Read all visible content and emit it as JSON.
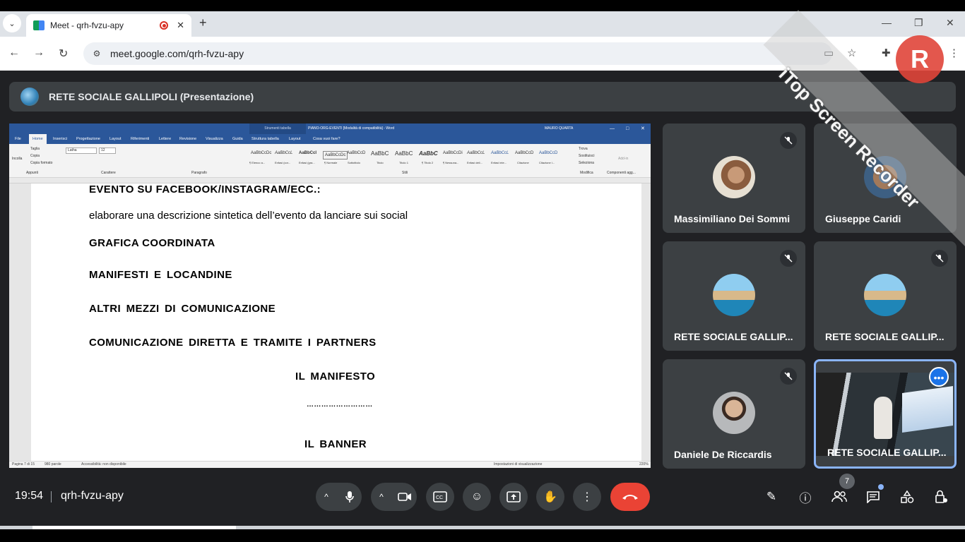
{
  "browser": {
    "tab_title": "Meet - qrh-fvzu-apy",
    "url": "meet.google.com/qrh-fvzu-apy"
  },
  "meet": {
    "presenter_label": "RETE SOCIALE GALLIPOLI (Presentazione)",
    "clock": "19:54",
    "meeting_code": "qrh-fvzu-apy",
    "participant_count": "7"
  },
  "word": {
    "context_tab": "Strumenti tabella",
    "doc_title": "PIANO-ORG-EVENTI [Modalità di compatibilità] - Word",
    "user": "MAURO QUARTA",
    "tabs": [
      "File",
      "Home",
      "Inserisci",
      "Progettazione",
      "Layout",
      "Riferimenti",
      "Lettere",
      "Revisione",
      "Visualizza",
      "Guida",
      "Struttura tabella",
      "Layout",
      "Cosa vuoi fare?"
    ],
    "font_name": "Latha",
    "font_size": "12",
    "clipboard": [
      "Taglia",
      "Copia",
      "Copia formato",
      "Incolla"
    ],
    "groups": [
      "Appunti",
      "Carattere",
      "Paragrafo",
      "Stili",
      "Modifica",
      "Componenti agg..."
    ],
    "styles": [
      "AaBbCcDc",
      "AaBbCcL",
      "AaBbCcI",
      "AaBbCcDc",
      "AaBbCcD",
      "AaBbC",
      "AaBbC",
      "AaBbC",
      "AaBbCcDi",
      "AaBbCcL",
      "AaBbCcL",
      "AaBbCcD",
      "AaBbCcD"
    ],
    "style_names": [
      "¶ Elenco a...",
      "Enfasi (cor...",
      "Enfasi (gra...",
      "¶ Normale",
      "Sottotitolo",
      "Titolo",
      "Titolo 1",
      "¶ Titolo 2",
      "¶ Nessuna...",
      "Enfasi deli...",
      "Enfasi inte...",
      "Citazione",
      "Citazione i..."
    ],
    "editing": [
      "Trova",
      "Sostituisci",
      "Seleziona"
    ],
    "addins": "Add-in",
    "status_page": "Pagina 7 di 15",
    "status_words": "980 parole",
    "status_access": "Accessibilità: non disponibile",
    "status_display": "Impostazioni di visualizzazione",
    "status_zoom": "220%",
    "doc_lines": [
      "EVENTO SU FACEBOOK/INSTAGRAM/ECC.:",
      "elaborare una descrizione sintetica dell’evento da lanciare sui social",
      "GRAFICA COORDINATA",
      "MANIFESTI  E  LOCANDINE",
      "ALTRI  MEZZI  DI  COMUNICAZIONE",
      "COMUNICAZIONE  DIRETTA  E  TRAMITE  I  PARTNERS",
      "IL  MANIFESTO",
      "………………………",
      "IL  BANNER"
    ]
  },
  "participants": [
    {
      "name": "Massimiliano Dei Sommi"
    },
    {
      "name": "Giuseppe Caridi"
    },
    {
      "name": "RETE SOCIALE GALLIP..."
    },
    {
      "name": "RETE SOCIALE GALLIP..."
    },
    {
      "name": "Daniele De Riccardis"
    },
    {
      "name": "RETE SOCIALE GALLIP..."
    }
  ],
  "watermark": "iTop Screen Recorder",
  "icons": [
    "search-icon",
    "mic-icon",
    "camera-icon",
    "captions-icon",
    "emoji-icon",
    "present-icon",
    "raise-hand-icon",
    "more-icon",
    "end-call-icon",
    "info-icon",
    "people-icon",
    "chat-icon",
    "activities-icon",
    "host-controls-icon"
  ]
}
